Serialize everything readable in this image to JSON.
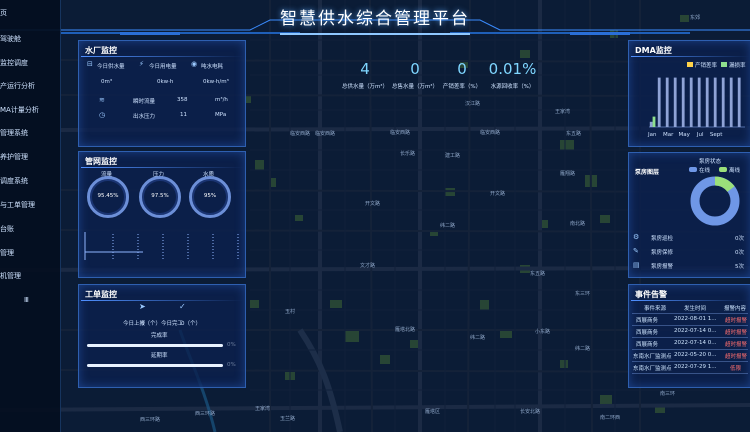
{
  "title": "智慧供水综合管理平台",
  "sidebar": {
    "items": [
      "页",
      "驾驶舱",
      "监控调度",
      "产运行分析",
      "MA计量分析",
      "管理系统",
      "养护管理",
      "调度系统",
      "与工单管理",
      "台账",
      "管理",
      "机管理"
    ],
    "collapse": "Ⅲ"
  },
  "topstats": [
    {
      "value": "4",
      "label": "总供水量（万m³）"
    },
    {
      "value": "0",
      "label": "总售水量（万m³）"
    },
    {
      "value": "0",
      "label": "产销差率（%）"
    },
    {
      "value": "0.01%",
      "label": "水源回收率（%）"
    }
  ],
  "water_plant": {
    "title": "水厂监控",
    "items": [
      {
        "label": "今日供水量",
        "value": "0m³"
      },
      {
        "label": "今日用电量",
        "value": "0kw·h"
      },
      {
        "label": "吨水电耗",
        "value": "0kw·h/m³"
      }
    ],
    "rows": [
      {
        "label": "瞬时流量",
        "value": "358",
        "unit": "m³/h"
      },
      {
        "label": "出水压力",
        "value": "11",
        "unit": "MPa"
      }
    ]
  },
  "pipe_network": {
    "title": "管网监控",
    "rings": [
      {
        "label": "流量",
        "value": "95.45%"
      },
      {
        "label": "压力",
        "value": "97.5%"
      },
      {
        "label": "水质",
        "value": "95%"
      }
    ]
  },
  "work_orders": {
    "title": "工单监控",
    "stats": [
      {
        "label": "今日上报",
        "value": "0（个）"
      },
      {
        "label": "今日完工",
        "value": "0（个）"
      }
    ],
    "bars": [
      {
        "label": "完成率",
        "percent": "0%",
        "value": 0
      },
      {
        "label": "延期率",
        "percent": "0%",
        "value": 0
      }
    ]
  },
  "dma": {
    "title": "DMA监控",
    "legend": [
      {
        "label": "产销差率",
        "color": "#ffd24a"
      },
      {
        "label": "漏损率",
        "color": "#8ee08e"
      }
    ]
  },
  "pump": {
    "title": "泵房监控",
    "subtitle": "泵房图层",
    "chart_title": "泵房状态",
    "legend": [
      {
        "label": "在线",
        "color": "#6f97e6"
      },
      {
        "label": "离线",
        "color": "#9be07a"
      }
    ],
    "rows": [
      {
        "label": "泵房巡检",
        "value": "0次"
      },
      {
        "label": "泵房保修",
        "value": "0次"
      },
      {
        "label": "泵房报警",
        "value": "5次"
      }
    ]
  },
  "events": {
    "title": "事件告警",
    "headers": [
      "事件来源",
      "发生时间",
      "报警内容"
    ],
    "rows": [
      {
        "source": "西展商务",
        "time": "2022-08-01 1...",
        "content": "超时报警"
      },
      {
        "source": "西展商务",
        "time": "2022-07-14 0...",
        "content": "超时报警"
      },
      {
        "source": "西展商务",
        "time": "2022-07-14 0...",
        "content": "超时报警"
      },
      {
        "source": "东南水厂监测点",
        "time": "2022-05-20 0...",
        "content": "超时报警"
      },
      {
        "source": "东南水厂监测点",
        "time": "2022-07-29 1...",
        "content": "低限"
      }
    ]
  },
  "map_labels": [
    "临安西路",
    "临安西路",
    "临安西路",
    "临安西路",
    "汉江路",
    "建工路",
    "开文路",
    "开文路",
    "文才路",
    "玉村",
    "西三环路",
    "西三环路",
    "王家湾",
    "玉兰路",
    "雁塔区",
    "长安北路",
    "南二环西",
    "王家湾",
    "东五路",
    "东五路",
    "东郊",
    "雁翔路",
    "东三环",
    "纬二路",
    "纬二路",
    "纬二路",
    "小东路",
    "南三环",
    "长乐路",
    "南北路",
    "雁塔北路"
  ],
  "chart_data": {
    "type": "bar",
    "title": "",
    "categories": [
      "Jan",
      "Feb",
      "Mar",
      "Apr",
      "May",
      "Jun",
      "Jul",
      "Aug",
      "Sep",
      "Oct",
      "Nov",
      "Dec"
    ],
    "series": [
      {
        "name": "产销差率",
        "values": [
          0.1,
          0.95,
          0.95,
          0.95,
          0.95,
          0.95,
          0.95,
          0.95,
          0.95,
          0.95,
          0.95,
          0.95
        ]
      },
      {
        "name": "漏损率",
        "values": [
          0.2,
          0,
          0,
          0,
          0,
          0,
          0,
          0,
          0,
          0,
          0,
          0
        ]
      }
    ],
    "xticks": [
      "Jan",
      "Mar",
      "May",
      "Jul",
      "Sept"
    ],
    "ylim": [
      0,
      1
    ]
  }
}
